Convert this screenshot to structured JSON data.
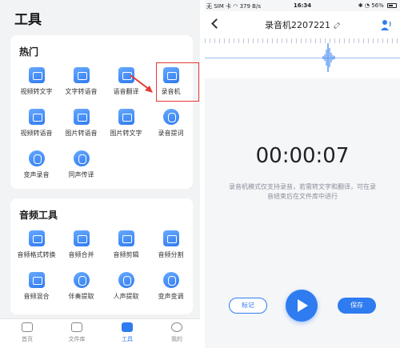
{
  "left": {
    "title": "工具",
    "hot": {
      "heading": "热门",
      "items": [
        {
          "label": "视频转文字",
          "icon": "video-text-icon"
        },
        {
          "label": "文字转语音",
          "icon": "text-speech-icon"
        },
        {
          "label": "语音翻译",
          "icon": "voice-translate-icon"
        },
        {
          "label": "录音机",
          "icon": "recorder-icon"
        },
        {
          "label": "视频转语音",
          "icon": "video-audio-icon"
        },
        {
          "label": "图片转语音",
          "icon": "image-audio-icon"
        },
        {
          "label": "图片转文字",
          "icon": "image-text-icon"
        },
        {
          "label": "录音提词",
          "icon": "teleprompter-icon"
        },
        {
          "label": "变声录音",
          "icon": "voice-change-icon"
        },
        {
          "label": "同声传译",
          "icon": "interpretation-icon"
        }
      ]
    },
    "audio": {
      "heading": "音频工具",
      "items": [
        {
          "label": "音频格式转换",
          "icon": "format-convert-icon"
        },
        {
          "label": "音频合并",
          "icon": "audio-merge-icon"
        },
        {
          "label": "音频剪辑",
          "icon": "audio-cut-icon"
        },
        {
          "label": "音频分割",
          "icon": "audio-split-icon"
        },
        {
          "label": "音频混合",
          "icon": "audio-mix-icon"
        },
        {
          "label": "伴奏提取",
          "icon": "accompaniment-icon"
        },
        {
          "label": "人声提取",
          "icon": "vocal-extract-icon"
        },
        {
          "label": "变声变调",
          "icon": "pitch-change-icon"
        }
      ]
    },
    "tabs": [
      {
        "label": "首页",
        "icon": "home-icon",
        "active": false
      },
      {
        "label": "文件库",
        "icon": "folder-icon",
        "active": false
      },
      {
        "label": "工具",
        "icon": "toolbox-icon",
        "active": true
      },
      {
        "label": "我的",
        "icon": "profile-icon",
        "active": false
      }
    ]
  },
  "right": {
    "status": {
      "carrier": "无 SIM 卡",
      "speed": "379 B/s",
      "time": "16:34",
      "battery": "56%"
    },
    "nav": {
      "title": "录音机2207221"
    },
    "timer": "00:00:07",
    "hint": "录音机模式仅支持录音，若需转文字和翻译，可在录音结束后在文件库中进行",
    "mark_label": "标记",
    "save_label": "保存"
  },
  "colors": {
    "accent": "#2f7bf0",
    "highlight": "#e53935"
  }
}
